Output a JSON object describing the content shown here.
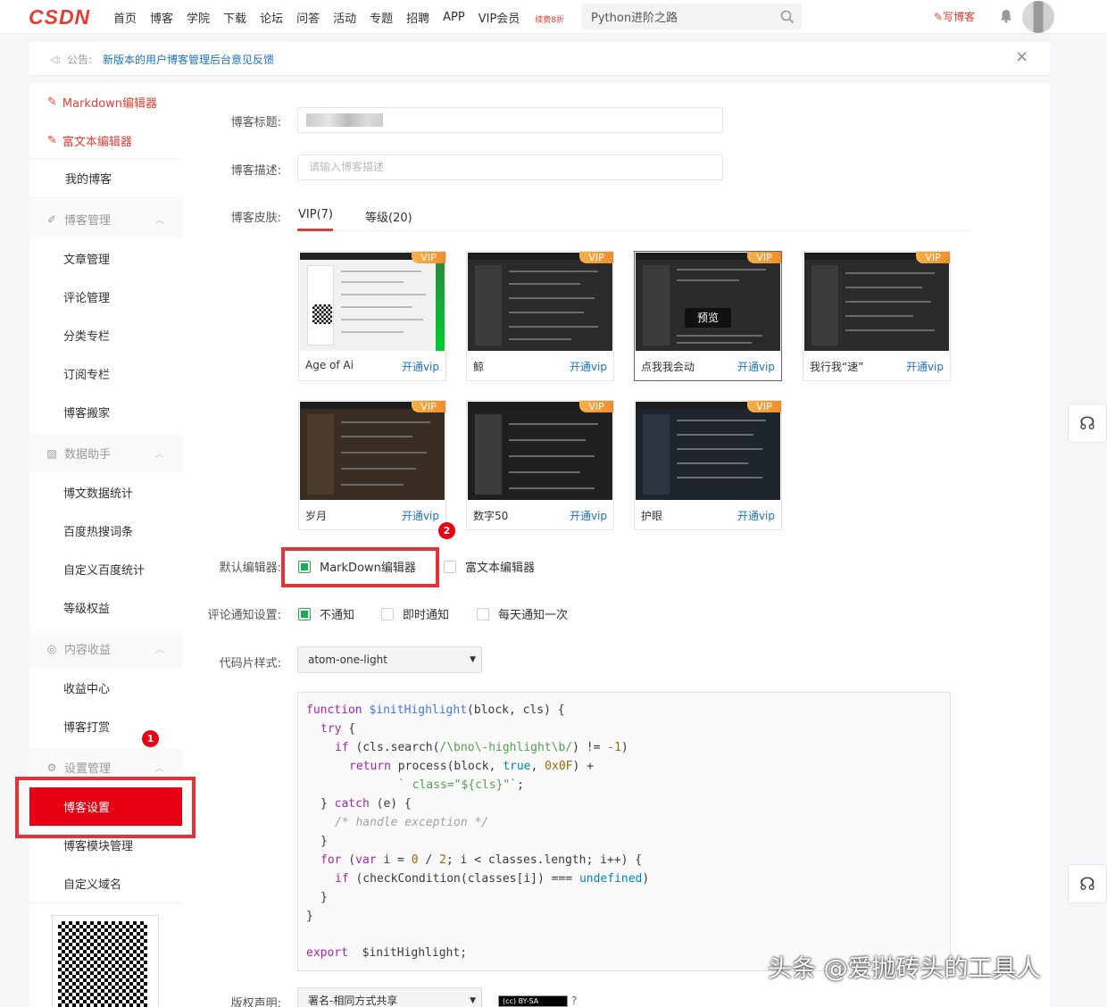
{
  "header": {
    "logo": "CSDN",
    "nav": [
      "首页",
      "博客",
      "学院",
      "下载",
      "论坛",
      "问答",
      "活动",
      "专题",
      "招聘",
      "APP",
      "VIP会员"
    ],
    "vip_badge": "续费8折",
    "search_value": "Python进阶之路",
    "write_label": "写博客"
  },
  "notice": {
    "label": "公告:",
    "text": "新版本的用户博客管理后台意见反馈"
  },
  "sidebar": {
    "markdown_editor": "Markdown编辑器",
    "richtext_editor": "富文本编辑器",
    "my_blog": "我的博客",
    "sections": [
      {
        "title": "博客管理",
        "items": [
          "文章管理",
          "评论管理",
          "分类专栏",
          "订阅专栏",
          "博客搬家"
        ]
      },
      {
        "title": "数据助手",
        "items": [
          "博文数据统计",
          "百度热搜词条",
          "自定义百度统计",
          "等级权益"
        ]
      },
      {
        "title": "内容收益",
        "items": [
          "收益中心",
          "博客打赏"
        ]
      },
      {
        "title": "设置管理",
        "items": [
          "博客设置",
          "博客模块管理",
          "自定义域名"
        ]
      }
    ]
  },
  "form": {
    "title_label": "博客标题:",
    "desc_label": "博客描述:",
    "desc_placeholder": "请输入博客描述",
    "skin_label": "博客皮肤:",
    "skin_tabs": [
      "VIP(7)",
      "等级(20)"
    ],
    "skins": [
      {
        "name": "Age of Ai",
        "action": "开通vip",
        "badge": "VIP",
        "theme": "light"
      },
      {
        "name": "鲸",
        "action": "开通vip",
        "badge": "VIP",
        "theme": "dark"
      },
      {
        "name": "点我我会动",
        "action": "开通vip",
        "badge": "VIP",
        "theme": "dark",
        "preview": "预览"
      },
      {
        "name": "我行我“速”",
        "action": "开通vip",
        "badge": "VIP",
        "theme": "dark"
      },
      {
        "name": "岁月",
        "action": "开通vip",
        "badge": "VIP",
        "theme": "dark"
      },
      {
        "name": "数字50",
        "action": "开通vip",
        "badge": "VIP",
        "theme": "dark"
      },
      {
        "name": "护眼",
        "action": "开通vip",
        "badge": "VIP",
        "theme": "dark"
      }
    ],
    "editor_label": "默认编辑器:",
    "editor_options": [
      "MarkDown编辑器",
      "富文本编辑器"
    ],
    "comment_label": "评论通知设置:",
    "comment_options": [
      "不通知",
      "即时通知",
      "每天通知一次"
    ],
    "code_style_label": "代码片样式:",
    "code_style_value": "atom-one-light",
    "copyright_label": "版权声明:",
    "copyright_value": "署名-相同方式共享",
    "cc_badge": "(cc) BY-SA",
    "help": "?"
  },
  "code_sample": {
    "l1_kw": "function",
    "l1_fn": "$initHighlight",
    "l1_rest": "(block, cls) {",
    "l2_kw": "try",
    "l2_rest": " {",
    "l3_kw": "if",
    "l3_a": " (cls.search(",
    "l3_re": "/\\bno\\-highlight\\b/",
    "l3_b": ") != ",
    "l3_num": "-1",
    "l3_c": ")",
    "l4_kw": "return",
    "l4_a": " process(block, ",
    "l4_lit": "true",
    "l4_b": ", ",
    "l4_num": "0x0F",
    "l4_c": ") +",
    "l5_str": "` class=\"${cls}\"`",
    "l5_rest": ";",
    "l6_a": "} ",
    "l6_kw": "catch",
    "l6_rest": " (e) {",
    "l7_cm": "/* handle exception */",
    "l8": "}",
    "l9_kw": "for",
    "l9_a": " (",
    "l9_kw2": "var",
    "l9_b": " i = ",
    "l9_n1": "0",
    "l9_c": " / ",
    "l9_n2": "2",
    "l9_d": "; i < classes.length; i++) {",
    "l10_kw": "if",
    "l10_a": " (checkCondition(classes[i]) === ",
    "l10_lit": "undefined",
    "l10_b": ")",
    "l11": "}",
    "l12": "}",
    "l13_kw": "export",
    "l13_rest": "  $initHighlight;"
  },
  "annotations": {
    "badge1": "1",
    "badge2": "2"
  },
  "watermark": "头条 @爱抛砖头的工具人"
}
